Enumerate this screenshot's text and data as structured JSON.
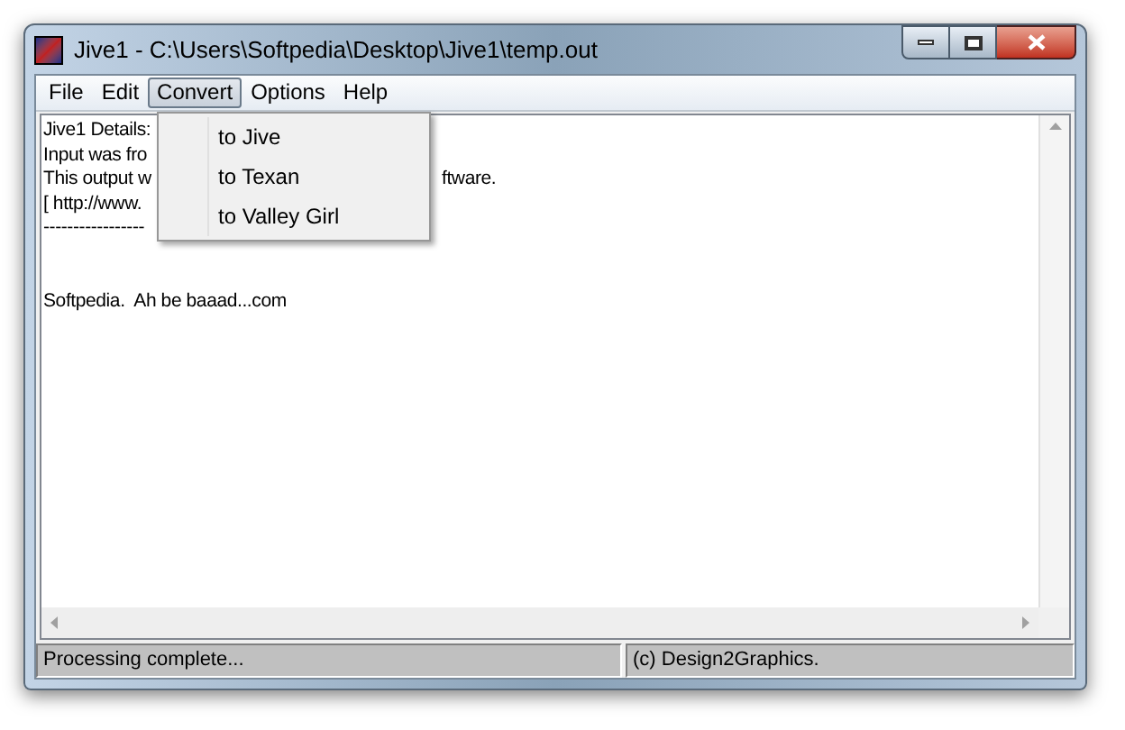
{
  "window": {
    "title": "Jive1 - C:\\Users\\Softpedia\\Desktop\\Jive1\\temp.out"
  },
  "menu_bar": [
    {
      "label": "File",
      "selected": false
    },
    {
      "label": "Edit",
      "selected": false
    },
    {
      "label": "Convert",
      "selected": true
    },
    {
      "label": "Options",
      "selected": false
    },
    {
      "label": "Help",
      "selected": false
    }
  ],
  "dropdown": {
    "items": [
      "to Jive",
      "to Texan",
      "to Valley Girl"
    ]
  },
  "document": {
    "lines": [
      "Jive1 Details:",
      "Input was fro",
      "This output w",
      "[ http://www.",
      "-----------------"
    ],
    "fragment": "ftware.",
    "note": "Softpedia.  Ah be baaad...com"
  },
  "status_bar": [
    "Processing complete...",
    "(c) Design2Graphics."
  ]
}
